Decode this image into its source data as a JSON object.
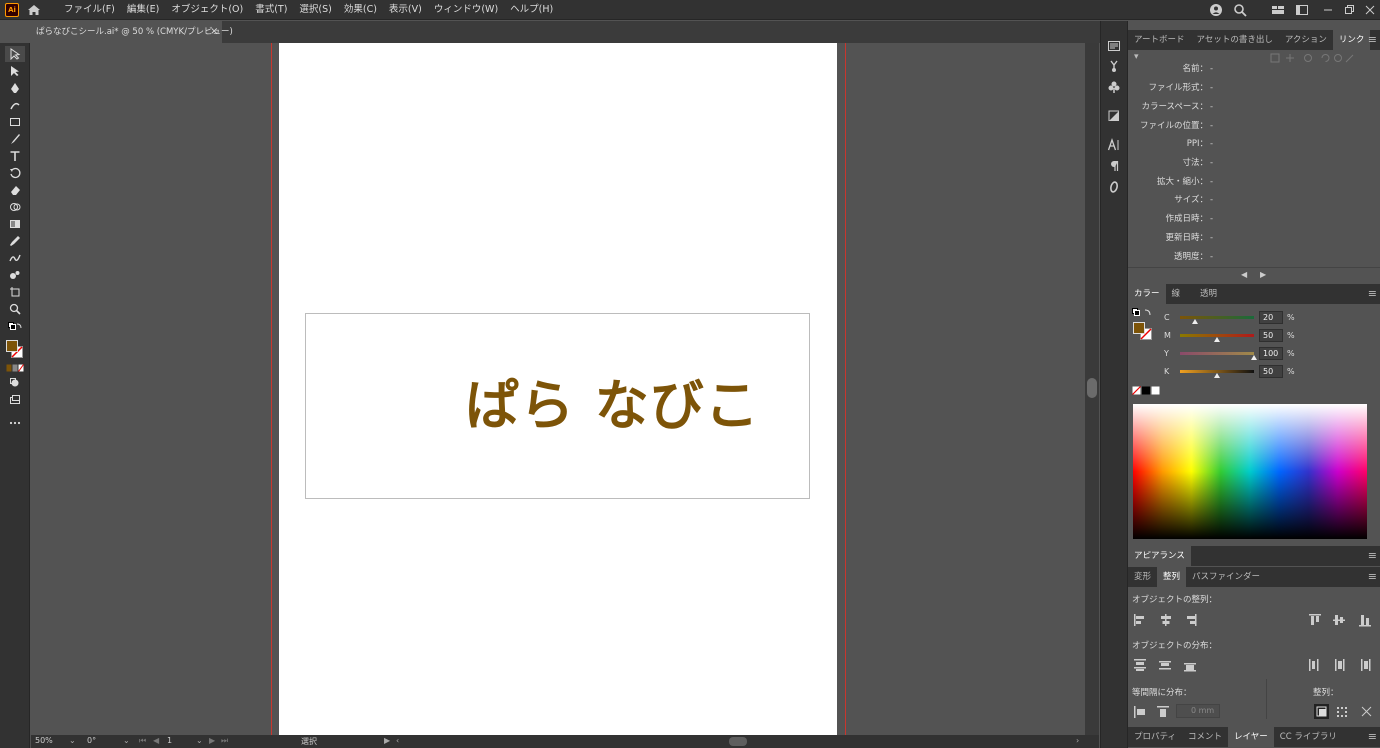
{
  "app": {
    "logo": "Ai"
  },
  "menu": [
    "ファイル(F)",
    "編集(E)",
    "オブジェクト(O)",
    "書式(T)",
    "選択(S)",
    "効果(C)",
    "表示(V)",
    "ウィンドウ(W)",
    "ヘルプ(H)"
  ],
  "document_tab": {
    "title": "ぱらなびこシール.ai* @ 50 % (CMYK/プレビュー)",
    "close": "×"
  },
  "artwork": {
    "text": "ぱら なびこ",
    "fill_color": "#7d5408"
  },
  "status": {
    "zoom": "50%",
    "rotation": "0°",
    "artboard_num": "1",
    "tool": "選択"
  },
  "panel_tabs_top": [
    "アートボード",
    "アセットの書き出し",
    "アクション",
    "リンク"
  ],
  "link_info": [
    {
      "label": "名前：",
      "value": "-"
    },
    {
      "label": "ファイル形式：",
      "value": "-"
    },
    {
      "label": "カラースペース：",
      "value": "-"
    },
    {
      "label": "ファイルの位置：",
      "value": "-"
    },
    {
      "label": "PPI：",
      "value": "-"
    },
    {
      "label": "寸法：",
      "value": "-"
    },
    {
      "label": "拡大・縮小：",
      "value": "-"
    },
    {
      "label": "サイズ：",
      "value": "-"
    },
    {
      "label": "作成日時：",
      "value": "-"
    },
    {
      "label": "更新日時：",
      "value": "-"
    },
    {
      "label": "透明度：",
      "value": "-"
    }
  ],
  "color_tabs": [
    "カラー",
    "線",
    "透明"
  ],
  "color": {
    "fill_swatch": "#7d5408",
    "channels": [
      {
        "name": "C",
        "value": "20",
        "unit": "%",
        "fraction": 0.2
      },
      {
        "name": "M",
        "value": "50",
        "unit": "%",
        "fraction": 0.5
      },
      {
        "name": "Y",
        "value": "100",
        "unit": "%",
        "fraction": 1.0
      },
      {
        "name": "K",
        "value": "50",
        "unit": "%",
        "fraction": 0.5
      }
    ]
  },
  "appearance_tab": "アピアランス",
  "align_tabs": [
    "変形",
    "整列",
    "パスファインダー"
  ],
  "align": {
    "objects_align": "オブジェクトの整列：",
    "objects_distribute": "オブジェクトの分布：",
    "distribute_spacing": "等間隔に分布：",
    "align_to": "整列：",
    "spacing_value": "0 mm"
  },
  "bottom_tabs": [
    "プロパティ",
    "コメント",
    "レイヤー",
    "CC ライブラリ"
  ]
}
